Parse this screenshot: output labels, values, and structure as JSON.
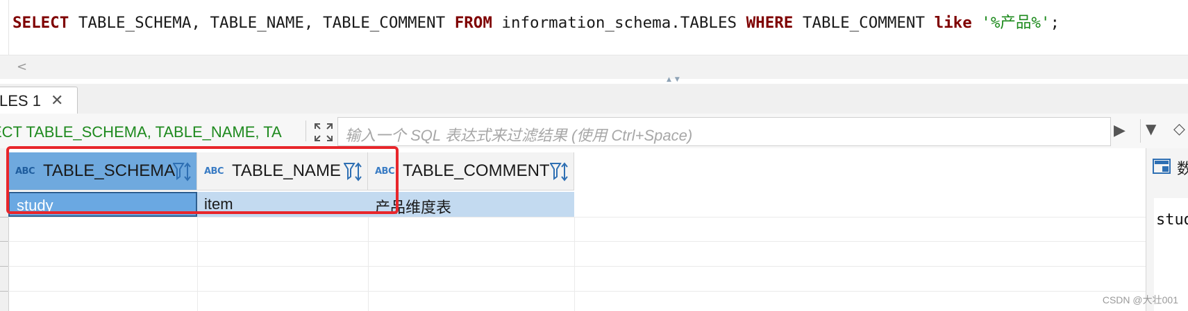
{
  "editor": {
    "sql_parts": [
      {
        "text": "SELECT",
        "kind": "kw"
      },
      {
        "text": " TABLE_SCHEMA, TABLE_NAME, TABLE_COMMENT ",
        "kind": "plain"
      },
      {
        "text": "FROM",
        "kind": "kw"
      },
      {
        "text": " information_schema.TABLES ",
        "kind": "plain"
      },
      {
        "text": "WHERE",
        "kind": "kw"
      },
      {
        "text": " TABLE_COMMENT ",
        "kind": "plain"
      },
      {
        "text": "like",
        "kind": "kw"
      },
      {
        "text": " '%产品%'",
        "kind": "str"
      },
      {
        "text": ";",
        "kind": "plain"
      }
    ]
  },
  "scroll": {
    "left_arrow": "<"
  },
  "results": {
    "tab_label": "LES 1",
    "tab_close": "✕",
    "query_text": "ECT TABLE_SCHEMA, TABLE_NAME, TA",
    "filter_placeholder": "输入一个 SQL 表达式来过滤结果 (使用 Ctrl+Space)",
    "columns": [
      {
        "type_badge": "ABC",
        "name": "TABLE_SCHEMA"
      },
      {
        "type_badge": "ABC",
        "name": "TABLE_NAME"
      },
      {
        "type_badge": "ABC",
        "name": "TABLE_COMMENT"
      }
    ],
    "rows": [
      [
        "study",
        "item",
        "产品维度表"
      ]
    ]
  },
  "side_panel": {
    "tab_char": "数",
    "value": "stud"
  },
  "watermark": "CSDN @大壮001",
  "colors": {
    "keyword": "#7f0000",
    "string": "#1c8a1c",
    "selection": "#6aa8e2",
    "highlight": "#e8262b"
  }
}
